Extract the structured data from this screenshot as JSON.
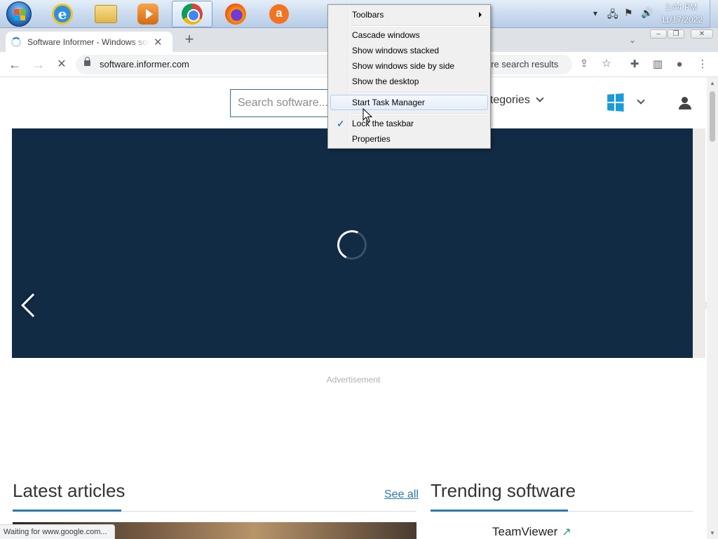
{
  "taskbar": {
    "apps": [
      {
        "name": "Internet Explorer"
      },
      {
        "name": "Windows Explorer"
      },
      {
        "name": "Windows Media Player"
      },
      {
        "name": "Google Chrome",
        "active": true
      },
      {
        "name": "Mozilla Firefox"
      },
      {
        "name": "Avast Antivirus"
      }
    ],
    "clock_time": "1:44 PM",
    "clock_date": "11/17/2022"
  },
  "browser": {
    "tab_title": "Software Informer - Windows software",
    "url": "software.informer.com",
    "omnibox_hint": "ore search results",
    "status": "Waiting for www.google.com..."
  },
  "page": {
    "search_placeholder": "Search software...",
    "categories_label": "ategories",
    "advertisement": "Advertisement",
    "latest_articles": "Latest articles",
    "see_all": "See all",
    "trending_software": "Trending software",
    "trending_first": "TeamViewer"
  },
  "context_menu": {
    "items": [
      {
        "label": "Toolbars",
        "has_submenu": true
      },
      {
        "label": "Cascade windows"
      },
      {
        "label": "Show windows stacked"
      },
      {
        "label": "Show windows side by side"
      },
      {
        "label": "Show the desktop"
      },
      {
        "label": "Start Task Manager",
        "highlighted": true
      },
      {
        "label": "Lock the taskbar",
        "checked": true
      },
      {
        "label": "Properties"
      }
    ]
  },
  "colors": {
    "slider_bg": "#112b44",
    "accent": "#2b78a8",
    "chrome_frame": "#dee1e6"
  }
}
